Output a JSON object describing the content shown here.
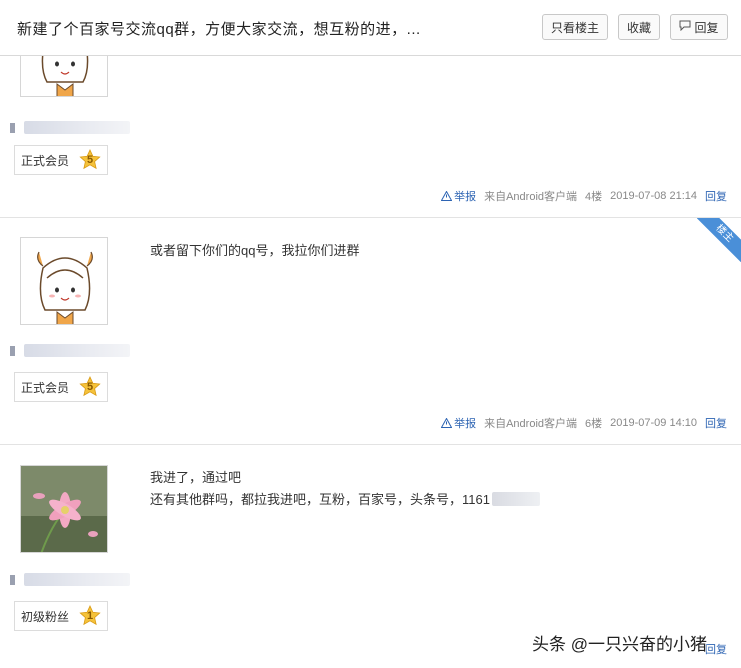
{
  "header": {
    "title": "新建了个百家号交流qq群，方便大家交流，想互粉的进，...",
    "buttons": [
      {
        "label": "只看楼主"
      },
      {
        "label": "收藏"
      },
      {
        "label": "回复",
        "icon": "comment-icon"
      }
    ]
  },
  "posts": [
    {
      "rank_title": "正式会员",
      "level": "5",
      "content_lines": [],
      "report_label": "举报",
      "source": "来自Android客户端",
      "floor": "4楼",
      "time": "2019-07-08 21:14",
      "reply_label": "回复"
    },
    {
      "is_op": true,
      "op_label": "楼主",
      "rank_title": "正式会员",
      "level": "5",
      "content_lines": [
        "或者留下你们的qq号，我拉你们进群"
      ],
      "report_label": "举报",
      "source": "来自Android客户端",
      "floor": "6楼",
      "time": "2019-07-09 14:10",
      "reply_label": "回复"
    },
    {
      "rank_title": "初级粉丝",
      "level": "1",
      "content_lines": [
        "我进了，通过吧",
        "还有其他群吗，都拉我进吧，互粉，百家号，头条号，1161"
      ],
      "reply_label": "回复"
    }
  ],
  "watermark": "头条 @一只兴奋的小猪",
  "colors": {
    "link": "#2d64b3",
    "star": "#f5c23a",
    "op_ribbon": "#4a8fd8"
  }
}
